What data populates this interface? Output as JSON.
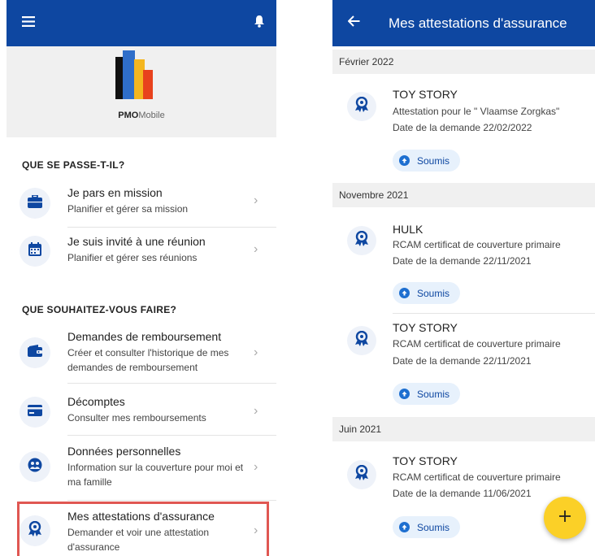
{
  "colors": {
    "primary": "#0e47a1",
    "accent_fab": "#fbd027",
    "highlight": "#e05752",
    "status": "#1e6fd0"
  },
  "left": {
    "logo": {
      "brand_bold": "PMO",
      "brand_light": "Mobile"
    },
    "section1_title": "QUE SE PASSE-T-IL?",
    "section1_items": [
      {
        "title": "Je pars en mission",
        "subtitle": "Planifier et gérer sa mission",
        "icon": "briefcase-icon"
      },
      {
        "title": "Je suis invité à une réunion",
        "subtitle": "Planifier et gérer ses réunions",
        "icon": "calendar-icon"
      }
    ],
    "section2_title": "QUE SOUHAITEZ-VOUS FAIRE?",
    "section2_items": [
      {
        "title": "Demandes de remboursement",
        "subtitle": "Créer et consulter l'historique de mes demandes de remboursement",
        "icon": "wallet-icon"
      },
      {
        "title": "Décomptes",
        "subtitle": "Consulter mes remboursements",
        "icon": "credit-card-icon"
      },
      {
        "title": "Données personnelles",
        "subtitle": "Information sur la couverture pour moi et ma famille",
        "icon": "family-icon"
      },
      {
        "title": "Mes attestations d'assurance",
        "subtitle": "Demander et voir une attestation d'assurance",
        "icon": "certificate-icon"
      }
    ]
  },
  "right": {
    "title": "Mes attestations d'assurance",
    "groups": [
      {
        "month": "Février 2022",
        "items": [
          {
            "title": "TOY STORY",
            "description": "Attestation pour le \" Vlaamse Zorgkas\"",
            "date": "Date de la demande 22/02/2022",
            "status": "Soumis"
          }
        ]
      },
      {
        "month": "Novembre 2021",
        "items": [
          {
            "title": "HULK",
            "description": "RCAM certificat de couverture primaire",
            "date": "Date de la demande 22/11/2021",
            "status": "Soumis"
          },
          {
            "title": "TOY STORY",
            "description": "RCAM certificat de couverture primaire",
            "date": "Date de la demande 22/11/2021",
            "status": "Soumis"
          }
        ]
      },
      {
        "month": "Juin 2021",
        "items": [
          {
            "title": "TOY STORY",
            "description": "RCAM certificat de couverture primaire",
            "date": "Date de la demande 11/06/2021",
            "status": "Soumis"
          }
        ]
      }
    ]
  }
}
